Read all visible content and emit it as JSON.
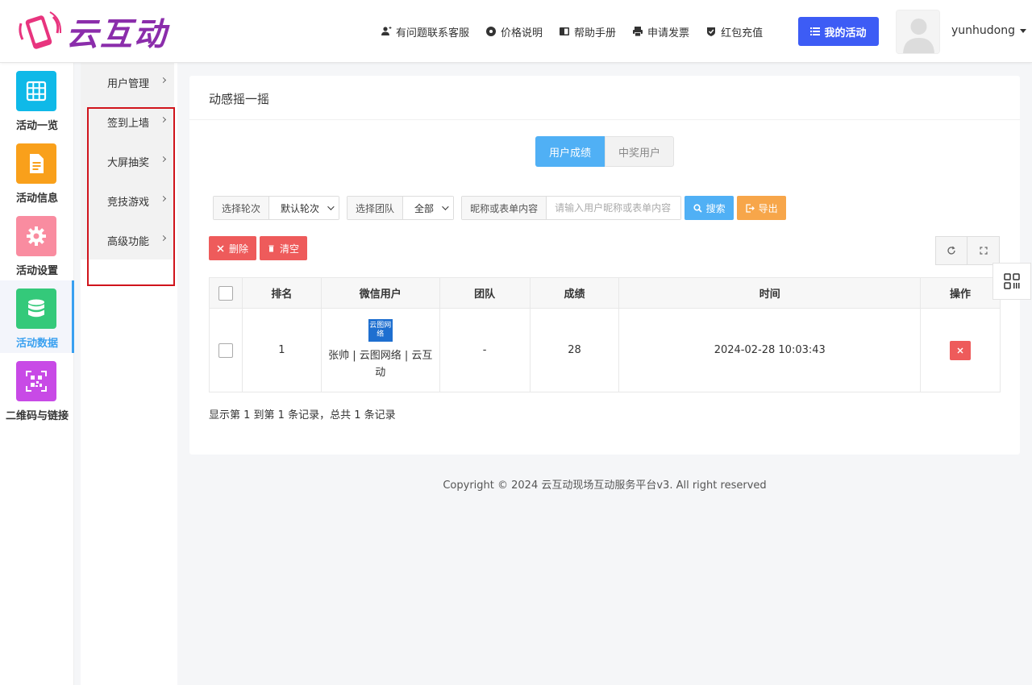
{
  "header": {
    "logo_text": "云互动",
    "nav": [
      {
        "label": "有问题联系客服",
        "icon": "add-user-icon"
      },
      {
        "label": "价格说明",
        "icon": "gear-badge-icon"
      },
      {
        "label": "帮助手册",
        "icon": "book-icon"
      },
      {
        "label": "申请发票",
        "icon": "printer-icon"
      },
      {
        "label": "红包充值",
        "icon": "shield-check-icon"
      }
    ],
    "my_activity_label": "我的活动",
    "username": "yunhudong"
  },
  "sidebar": {
    "items": [
      {
        "label": "活动一览",
        "icon": "grid-icon",
        "color": "#0fb9e8"
      },
      {
        "label": "活动信息",
        "icon": "document-icon",
        "color": "#f9a01b"
      },
      {
        "label": "活动设置",
        "icon": "gear-icon",
        "color": "#f98ca0"
      },
      {
        "label": "活动数据",
        "icon": "database-icon",
        "color": "#34c97a"
      },
      {
        "label": "二维码与链接",
        "icon": "qrcode-icon",
        "color": "#c84ae6"
      }
    ],
    "active_index": 3
  },
  "submenu": {
    "items": [
      "用户管理",
      "签到上墙",
      "大屏抽奖",
      "竞技游戏",
      "高级功能"
    ]
  },
  "card": {
    "title": "动感摇一摇",
    "tabs": [
      "用户成绩",
      "中奖用户"
    ],
    "filters": {
      "round_label": "选择轮次",
      "round_value": "默认轮次",
      "team_label": "选择团队",
      "team_value": "全部",
      "keyword_label": "昵称或表单内容",
      "keyword_placeholder": "请输入用户昵称或表单内容",
      "search_label": "搜索",
      "export_label": "导出"
    },
    "actions": {
      "delete_label": "删除",
      "clear_label": "清空"
    },
    "table": {
      "headers": [
        "排名",
        "微信用户",
        "团队",
        "成绩",
        "时间",
        "操作"
      ],
      "rows": [
        {
          "rank": "1",
          "avatar_text": "云图网络",
          "user": "张帅 | 云图网络 | 云互动",
          "team": "-",
          "score": "28",
          "time": "2024-02-28 10:03:43"
        }
      ]
    },
    "records_text": "显示第 1 到第 1 条记录，总共 1 条记录"
  },
  "footer": {
    "copyright": "Copyright © 2024 云互动现场互动服务平台v3. All right reserved"
  }
}
